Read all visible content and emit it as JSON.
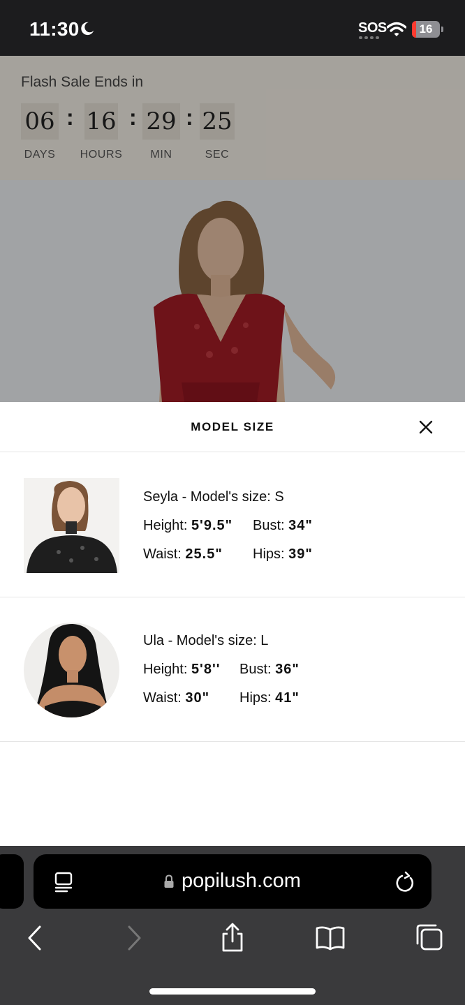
{
  "status_bar": {
    "time": "11:30",
    "carrier": "SOS",
    "battery_level": "16",
    "battery_fraction": 0.16,
    "battery_color": "#ff3b30"
  },
  "flash_sale": {
    "title": "Flash Sale Ends in",
    "days": "06",
    "hours": "16",
    "minutes": "29",
    "seconds": "25",
    "colon": ":",
    "days_label": "DAYS",
    "hours_label": "HOURS",
    "min_label": "MIN",
    "sec_label": "SEC"
  },
  "model_size_sheet": {
    "title": "MODEL SIZE",
    "models": [
      {
        "name_line": "Seyla - Model's size: S",
        "height_label": "Height:",
        "height_value": "5'9.5\"",
        "bust_label": "Bust:",
        "bust_value": "34\"",
        "waist_label": "Waist:",
        "waist_value": "25.5\"",
        "hips_label": "Hips:",
        "hips_value": "39\""
      },
      {
        "name_line": "Ula - Model's size: L",
        "height_label": "Height:",
        "height_value": "5'8''",
        "bust_label": "Bust:",
        "bust_value": "36\"",
        "waist_label": "Waist:",
        "waist_value": "30\"",
        "hips_label": "Hips:",
        "hips_value": "41\""
      }
    ]
  },
  "browser": {
    "url": "popilush.com"
  },
  "icons": {
    "close": "close-icon",
    "reader": "reader-icon",
    "lock": "lock-icon",
    "reload": "reload-icon",
    "back": "chevron-left-icon",
    "forward": "chevron-right-icon",
    "share": "share-icon",
    "bookmarks": "book-icon",
    "tabs": "tabs-icon"
  }
}
